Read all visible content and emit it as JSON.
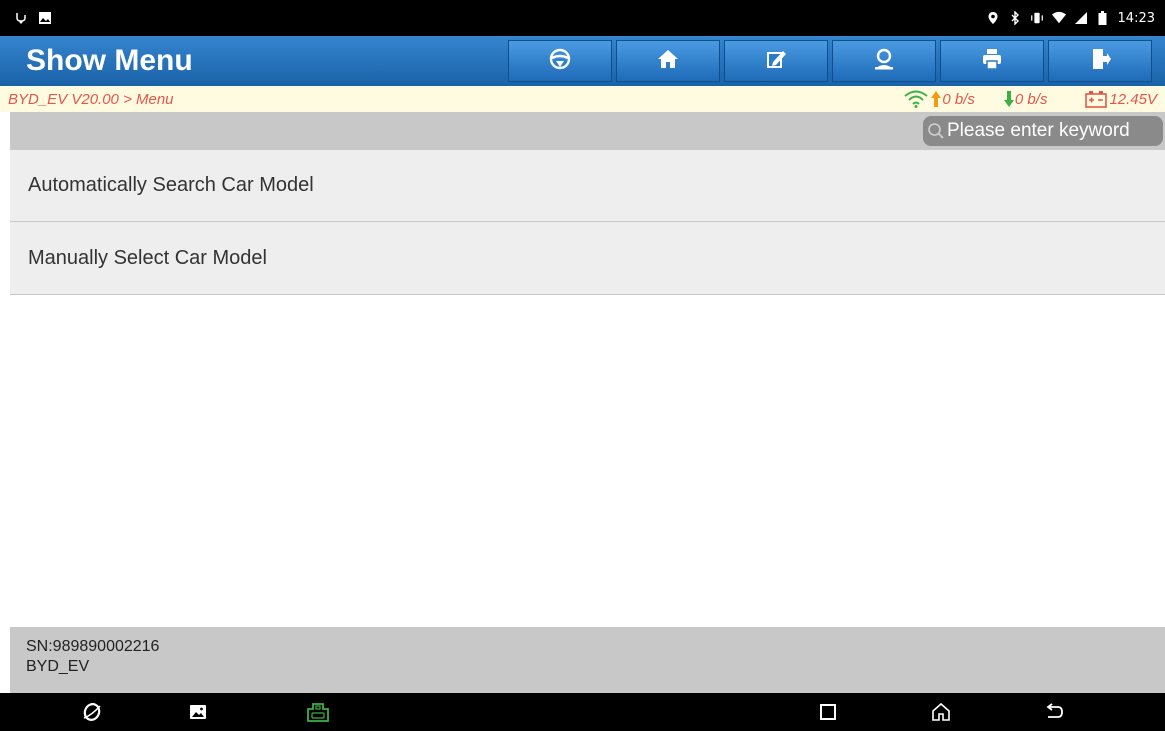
{
  "status_bar": {
    "time": "14:23",
    "left_icons": [
      "usb-debug-icon",
      "image-notification-icon"
    ],
    "right_icons": [
      "location-icon",
      "bluetooth-icon",
      "vibrate-icon",
      "wifi-icon",
      "signal-icon",
      "battery-icon"
    ]
  },
  "header": {
    "title": "Show Menu",
    "toolbar": [
      {
        "icon": "steering-wheel-icon"
      },
      {
        "icon": "home-icon"
      },
      {
        "icon": "edit-icon"
      },
      {
        "icon": "user-support-icon"
      },
      {
        "icon": "print-icon"
      },
      {
        "icon": "exit-icon"
      }
    ]
  },
  "breadcrumb": {
    "path": "BYD_EV V20.00 > Menu",
    "upload_rate": "0 b/s",
    "download_rate": "0 b/s",
    "battery_voltage": "12.45V"
  },
  "search": {
    "placeholder": "Please enter keyword"
  },
  "menu": {
    "items": [
      {
        "label": "Automatically Search Car Model"
      },
      {
        "label": "Manually Select Car Model"
      }
    ]
  },
  "footer": {
    "serial": "SN:989890002216",
    "model": "BYD_EV"
  },
  "nav_bar": {
    "left_icons": [
      "browser-icon",
      "gallery-icon",
      "vci-icon"
    ],
    "right_icons": [
      "recents-icon",
      "home-icon",
      "back-icon"
    ]
  },
  "colors": {
    "header_blue": "#1d6db6",
    "breadcrumb_text": "#e2574c",
    "wifi_green": "#3cb043",
    "upload_orange": "#f39c12",
    "download_green": "#3cb043",
    "vci_green": "#3cb043"
  }
}
